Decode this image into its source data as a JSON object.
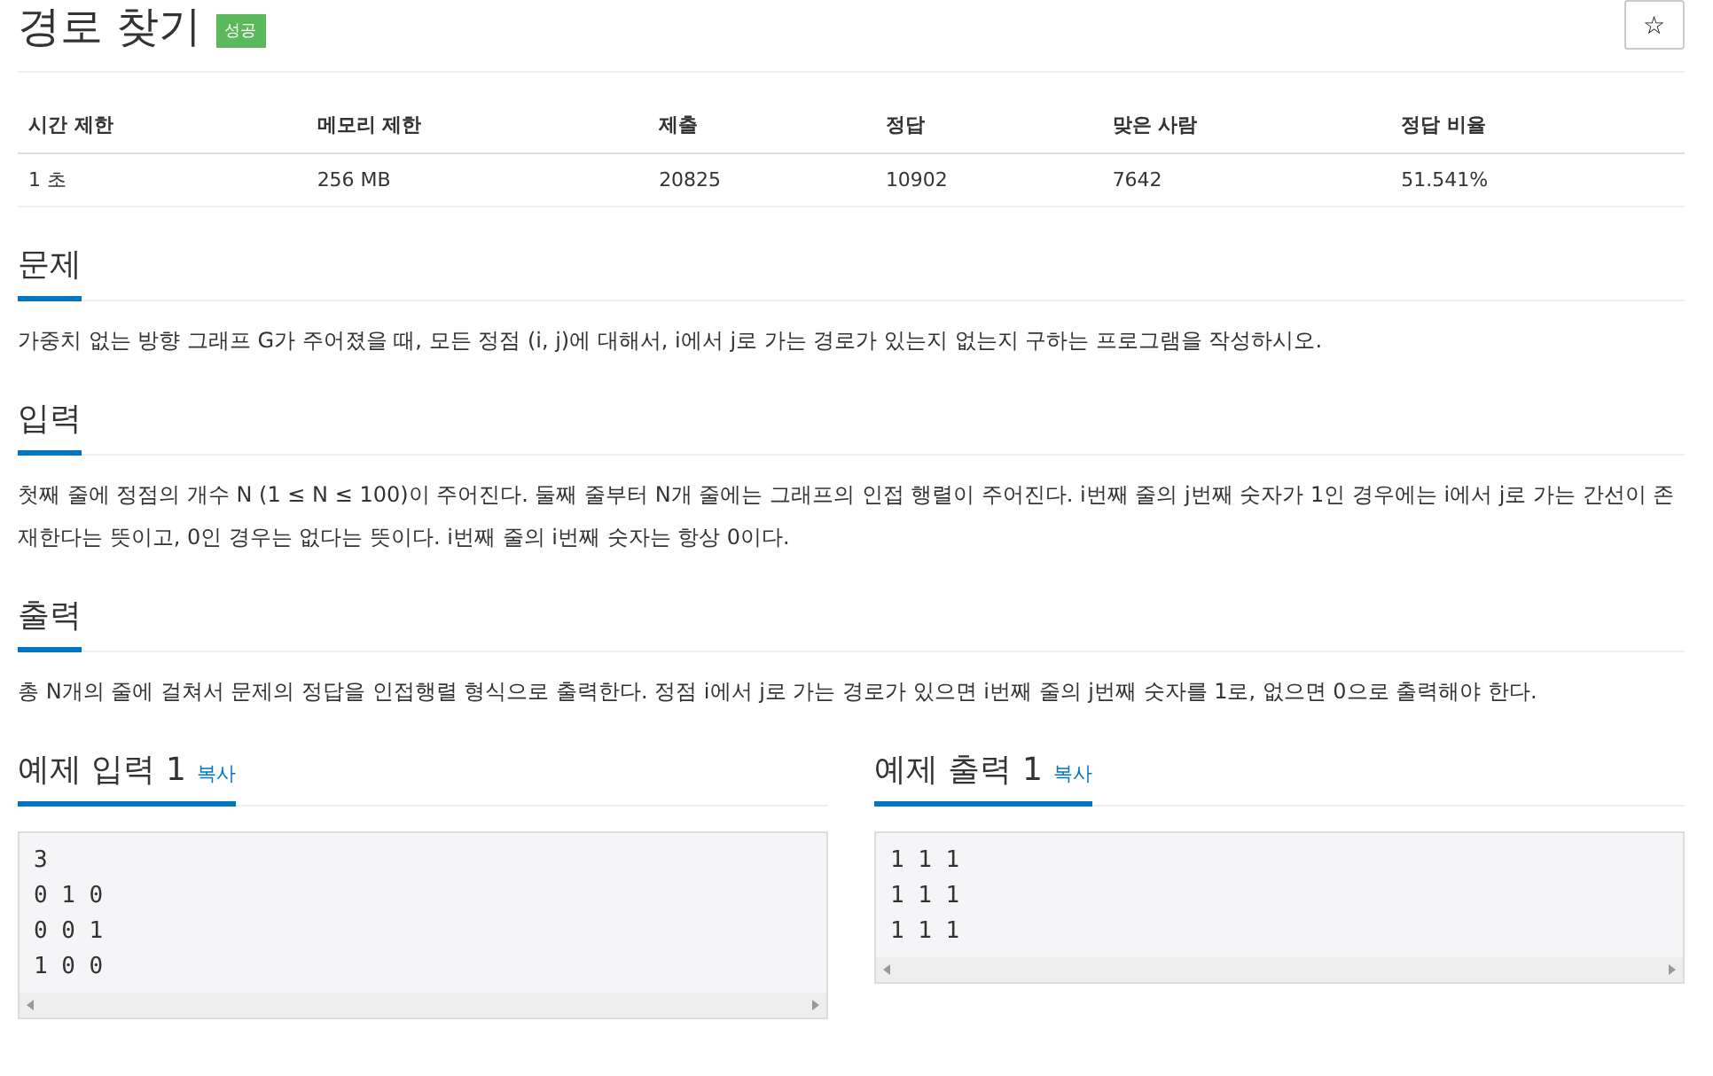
{
  "problem": {
    "title": "경로 찾기",
    "badge": "성공",
    "star_button": "☆"
  },
  "info_table": {
    "columns": [
      "시간 제한",
      "메모리 제한",
      "제출",
      "정답",
      "맞은 사람",
      "정답 비율"
    ],
    "rows": [
      [
        "1 초",
        "256 MB",
        "20825",
        "10902",
        "7642",
        "51.541%"
      ]
    ]
  },
  "sections": [
    {
      "heading": "문제",
      "paragraphs": [
        "가중치 없는 방향 그래프 G가 주어졌을 때, 모든 정점 (i, j)에 대해서, i에서 j로 가는 경로가 있는지 없는지 구하는 프로그램을 작성하시오."
      ]
    },
    {
      "heading": "입력",
      "paragraphs": [
        "첫째 줄에 정점의 개수 N (1 ≤ N ≤ 100)이 주어진다. 둘째 줄부터 N개 줄에는 그래프의 인접 행렬이 주어진다. i번째 줄의 j번째 숫자가 1인 경우에는 i에서 j로 가는 간선이 존재한다는 뜻이고, 0인 경우는 없다는 뜻이다. i번째 줄의 i번째 숫자는 항상 0이다."
      ]
    },
    {
      "heading": "출력",
      "paragraphs": [
        "총 N개의 줄에 걸쳐서 문제의 정답을 인접행렬 형식으로 출력한다. 정점 i에서 j로 가는 경로가 있으면 i번째 줄의 j번째 숫자를 1로, 없으면 0으로 출력해야 한다."
      ]
    }
  ],
  "samples": [
    {
      "heading": "예제 입력 1",
      "copy_link": "복사",
      "content": "3\n0 1 0\n0 0 1\n1 0 0"
    },
    {
      "heading": "예제 출력 1",
      "copy_link": "복사",
      "content": "1 1 1\n1 1 1\n1 1 1"
    }
  ]
}
